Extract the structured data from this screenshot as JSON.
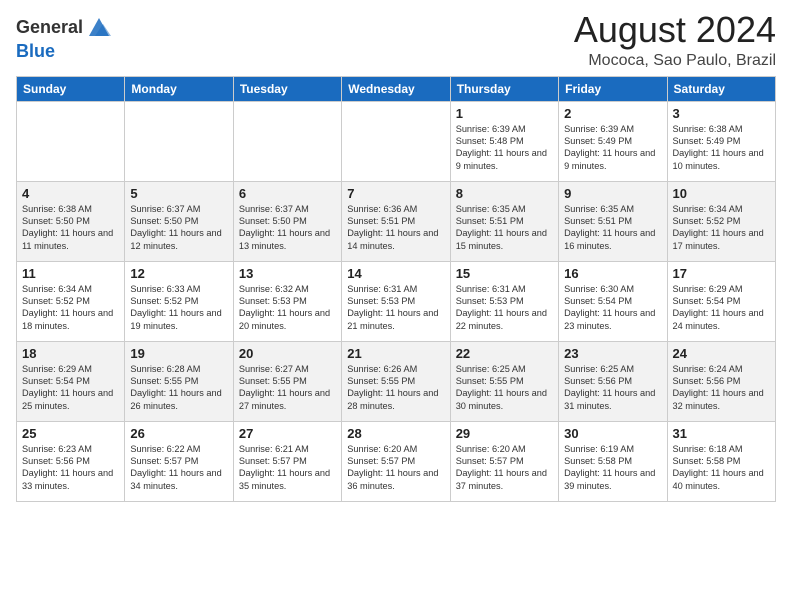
{
  "header": {
    "logo_general": "General",
    "logo_blue": "Blue",
    "month_title": "August 2024",
    "location": "Mococa, Sao Paulo, Brazil"
  },
  "days_of_week": [
    "Sunday",
    "Monday",
    "Tuesday",
    "Wednesday",
    "Thursday",
    "Friday",
    "Saturday"
  ],
  "weeks": [
    [
      {
        "day": "",
        "text": ""
      },
      {
        "day": "",
        "text": ""
      },
      {
        "day": "",
        "text": ""
      },
      {
        "day": "",
        "text": ""
      },
      {
        "day": "1",
        "text": "Sunrise: 6:39 AM\nSunset: 5:48 PM\nDaylight: 11 hours and 9 minutes."
      },
      {
        "day": "2",
        "text": "Sunrise: 6:39 AM\nSunset: 5:49 PM\nDaylight: 11 hours and 9 minutes."
      },
      {
        "day": "3",
        "text": "Sunrise: 6:38 AM\nSunset: 5:49 PM\nDaylight: 11 hours and 10 minutes."
      }
    ],
    [
      {
        "day": "4",
        "text": "Sunrise: 6:38 AM\nSunset: 5:50 PM\nDaylight: 11 hours and 11 minutes."
      },
      {
        "day": "5",
        "text": "Sunrise: 6:37 AM\nSunset: 5:50 PM\nDaylight: 11 hours and 12 minutes."
      },
      {
        "day": "6",
        "text": "Sunrise: 6:37 AM\nSunset: 5:50 PM\nDaylight: 11 hours and 13 minutes."
      },
      {
        "day": "7",
        "text": "Sunrise: 6:36 AM\nSunset: 5:51 PM\nDaylight: 11 hours and 14 minutes."
      },
      {
        "day": "8",
        "text": "Sunrise: 6:35 AM\nSunset: 5:51 PM\nDaylight: 11 hours and 15 minutes."
      },
      {
        "day": "9",
        "text": "Sunrise: 6:35 AM\nSunset: 5:51 PM\nDaylight: 11 hours and 16 minutes."
      },
      {
        "day": "10",
        "text": "Sunrise: 6:34 AM\nSunset: 5:52 PM\nDaylight: 11 hours and 17 minutes."
      }
    ],
    [
      {
        "day": "11",
        "text": "Sunrise: 6:34 AM\nSunset: 5:52 PM\nDaylight: 11 hours and 18 minutes."
      },
      {
        "day": "12",
        "text": "Sunrise: 6:33 AM\nSunset: 5:52 PM\nDaylight: 11 hours and 19 minutes."
      },
      {
        "day": "13",
        "text": "Sunrise: 6:32 AM\nSunset: 5:53 PM\nDaylight: 11 hours and 20 minutes."
      },
      {
        "day": "14",
        "text": "Sunrise: 6:31 AM\nSunset: 5:53 PM\nDaylight: 11 hours and 21 minutes."
      },
      {
        "day": "15",
        "text": "Sunrise: 6:31 AM\nSunset: 5:53 PM\nDaylight: 11 hours and 22 minutes."
      },
      {
        "day": "16",
        "text": "Sunrise: 6:30 AM\nSunset: 5:54 PM\nDaylight: 11 hours and 23 minutes."
      },
      {
        "day": "17",
        "text": "Sunrise: 6:29 AM\nSunset: 5:54 PM\nDaylight: 11 hours and 24 minutes."
      }
    ],
    [
      {
        "day": "18",
        "text": "Sunrise: 6:29 AM\nSunset: 5:54 PM\nDaylight: 11 hours and 25 minutes."
      },
      {
        "day": "19",
        "text": "Sunrise: 6:28 AM\nSunset: 5:55 PM\nDaylight: 11 hours and 26 minutes."
      },
      {
        "day": "20",
        "text": "Sunrise: 6:27 AM\nSunset: 5:55 PM\nDaylight: 11 hours and 27 minutes."
      },
      {
        "day": "21",
        "text": "Sunrise: 6:26 AM\nSunset: 5:55 PM\nDaylight: 11 hours and 28 minutes."
      },
      {
        "day": "22",
        "text": "Sunrise: 6:25 AM\nSunset: 5:55 PM\nDaylight: 11 hours and 30 minutes."
      },
      {
        "day": "23",
        "text": "Sunrise: 6:25 AM\nSunset: 5:56 PM\nDaylight: 11 hours and 31 minutes."
      },
      {
        "day": "24",
        "text": "Sunrise: 6:24 AM\nSunset: 5:56 PM\nDaylight: 11 hours and 32 minutes."
      }
    ],
    [
      {
        "day": "25",
        "text": "Sunrise: 6:23 AM\nSunset: 5:56 PM\nDaylight: 11 hours and 33 minutes."
      },
      {
        "day": "26",
        "text": "Sunrise: 6:22 AM\nSunset: 5:57 PM\nDaylight: 11 hours and 34 minutes."
      },
      {
        "day": "27",
        "text": "Sunrise: 6:21 AM\nSunset: 5:57 PM\nDaylight: 11 hours and 35 minutes."
      },
      {
        "day": "28",
        "text": "Sunrise: 6:20 AM\nSunset: 5:57 PM\nDaylight: 11 hours and 36 minutes."
      },
      {
        "day": "29",
        "text": "Sunrise: 6:20 AM\nSunset: 5:57 PM\nDaylight: 11 hours and 37 minutes."
      },
      {
        "day": "30",
        "text": "Sunrise: 6:19 AM\nSunset: 5:58 PM\nDaylight: 11 hours and 39 minutes."
      },
      {
        "day": "31",
        "text": "Sunrise: 6:18 AM\nSunset: 5:58 PM\nDaylight: 11 hours and 40 minutes."
      }
    ]
  ]
}
